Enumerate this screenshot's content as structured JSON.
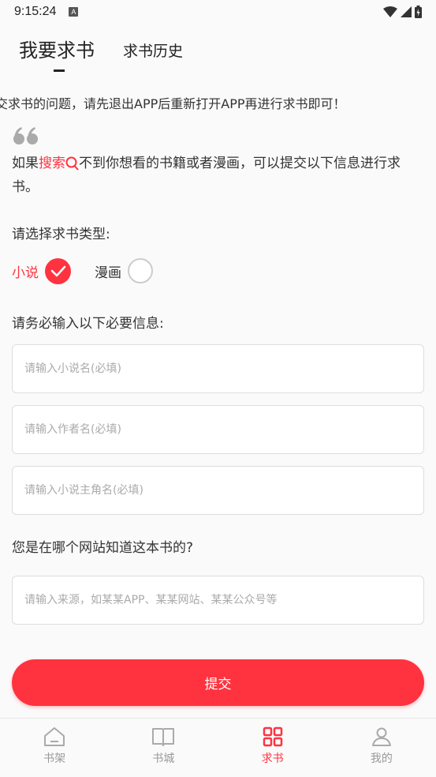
{
  "status_bar": {
    "time": "9:15:24",
    "notification_icon": "A"
  },
  "tabs": {
    "active": "我要求书",
    "history": "求书历史"
  },
  "notice": "交求书的问题，请先退出APP后重新打开APP再进行求书即可！",
  "intro": {
    "before": "如果",
    "search": "搜索",
    "after": "不到你想看的书籍或者漫画，可以提交以下信息进行求书。"
  },
  "type_label": "请选择求书类型:",
  "types": {
    "novel": "小说",
    "comic": "漫画",
    "selected": "小说"
  },
  "info_label": "请务必输入以下必要信息:",
  "fields": {
    "novel_name": "请输入小说名(必填)",
    "author_name": "请输入作者名(必填)",
    "protagonist": "请输入小说主角名(必填)"
  },
  "source_label": "您是在哪个网站知道这本书的?",
  "source_placeholder": "请输入来源，如某某APP、某某网站、某某公众号等",
  "submit": "提交",
  "nav": {
    "bookshelf": "书架",
    "bookstore": "书城",
    "request": "求书",
    "mine": "我的",
    "active": "求书"
  },
  "colors": {
    "accent": "#ff3340",
    "inactive": "#999999"
  }
}
